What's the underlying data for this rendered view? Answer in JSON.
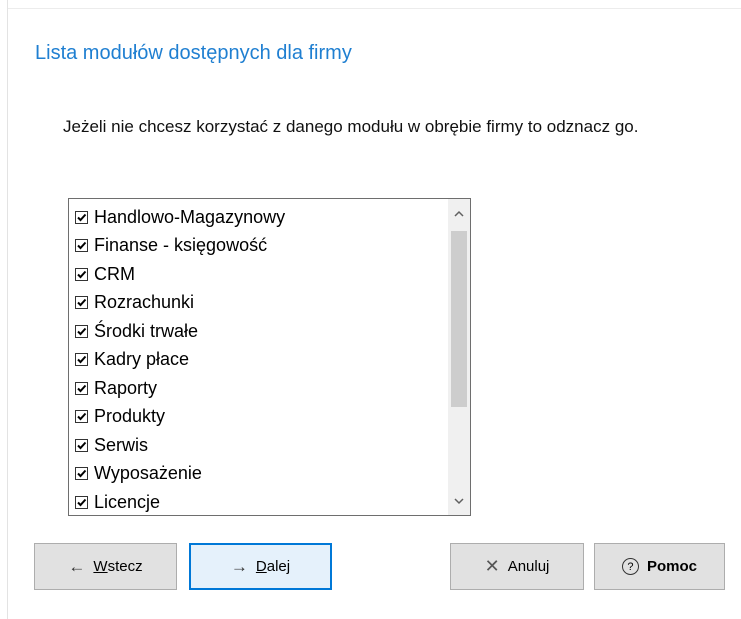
{
  "title": "Lista modułów dostępnych dla firmy",
  "description": "Jeżeli nie chcesz korzystać z danego modułu w obrębie firmy to odznacz go.",
  "modules": [
    {
      "label": "Handlowo-Magazynowy",
      "checked": true
    },
    {
      "label": "Finanse - księgowość",
      "checked": true
    },
    {
      "label": "CRM",
      "checked": true
    },
    {
      "label": "Rozrachunki",
      "checked": true
    },
    {
      "label": "Środki trwałe",
      "checked": true
    },
    {
      "label": "Kadry płace",
      "checked": true
    },
    {
      "label": "Raporty",
      "checked": true
    },
    {
      "label": "Produkty",
      "checked": true
    },
    {
      "label": "Serwis",
      "checked": true
    },
    {
      "label": "Wyposażenie",
      "checked": true
    },
    {
      "label": "Licencje",
      "checked": true
    }
  ],
  "buttons": {
    "back": {
      "arrow": "←",
      "mnemonic": "W",
      "rest": "stecz"
    },
    "next": {
      "arrow": "→",
      "mnemonic": "D",
      "rest": "alej"
    },
    "cancel": {
      "icon": "✕",
      "label": "Anuluj"
    },
    "help": {
      "icon": "?",
      "label": "Pomoc"
    }
  },
  "colors": {
    "title": "#1f7fd1",
    "primary_border": "#0078d7"
  }
}
